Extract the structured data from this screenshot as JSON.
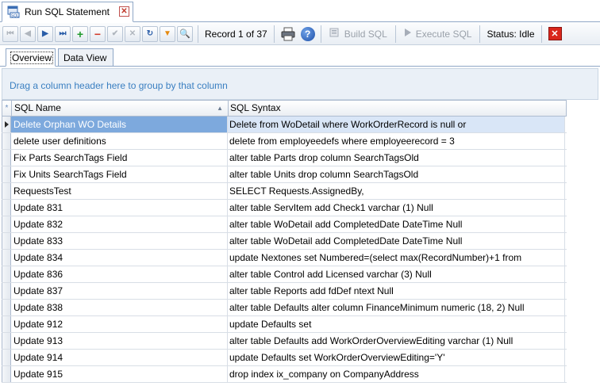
{
  "document_tab": {
    "title": "Run SQL Statement",
    "close_glyph": "✕"
  },
  "toolbar": {
    "first_glyph": "⏮",
    "prev_glyph": "◀",
    "next_glyph": "▶",
    "last_glyph": "⏭",
    "add_glyph": "+",
    "delete_glyph": "−",
    "post_glyph": "✔",
    "cancel_glyph": "✕",
    "refresh_glyph": "↻",
    "filter_glyph": "▼",
    "search_glyph": "🔍",
    "record_label": "Record 1 of 37",
    "help_glyph": "?",
    "build_sql_label": "Build SQL",
    "execute_sql_label": "Execute SQL",
    "status_label": "Status: Idle",
    "close_glyph": "✕"
  },
  "subtabs": [
    {
      "label": "Overview"
    },
    {
      "label": "Data View"
    }
  ],
  "group_panel": {
    "hint": "Drag a column header here to group by that column"
  },
  "grid": {
    "indicator_header": "*",
    "columns": [
      {
        "label": "SQL Name",
        "sort": "▲"
      },
      {
        "label": "SQL Syntax"
      }
    ],
    "rows": [
      {
        "name": "Delete Orphan WO Details",
        "syntax": "Delete from WoDetail where WorkOrderRecord is null or"
      },
      {
        "name": "delete user definitions",
        "syntax": "delete from employeedefs where employeerecord = 3"
      },
      {
        "name": "Fix Parts SearchTags Field",
        "syntax": "alter table Parts drop column SearchTagsOld"
      },
      {
        "name": "Fix Units SearchTags Field",
        "syntax": "alter table Units drop column SearchTagsOld"
      },
      {
        "name": "RequestsTest",
        "syntax": "SELECT Requests.AssignedBy,"
      },
      {
        "name": "Update 831",
        "syntax": "alter table ServItem add Check1 varchar (1) Null"
      },
      {
        "name": "Update 832",
        "syntax": "alter table WoDetail add CompletedDate DateTime Null"
      },
      {
        "name": "Update 833",
        "syntax": "alter table WoDetail add CompletedDate DateTime Null"
      },
      {
        "name": "Update 834",
        "syntax": "update Nextones set Numbered=(select max(RecordNumber)+1 from"
      },
      {
        "name": "Update 836",
        "syntax": "alter table Control add Licensed varchar (3) Null"
      },
      {
        "name": "Update 837",
        "syntax": "alter table Reports add fdDef ntext Null"
      },
      {
        "name": "Update 838",
        "syntax": "alter table Defaults alter column FinanceMinimum numeric (18, 2) Null"
      },
      {
        "name": "Update 912",
        "syntax": "update Defaults set"
      },
      {
        "name": "Update 913",
        "syntax": "alter table Defaults add WorkOrderOverviewEditing varchar (1) Null"
      },
      {
        "name": "Update 914",
        "syntax": "update Defaults set WorkOrderOverviewEditing='Y'"
      },
      {
        "name": "Update 915",
        "syntax": "drop index ix_company on CompanyAddress"
      }
    ]
  }
}
